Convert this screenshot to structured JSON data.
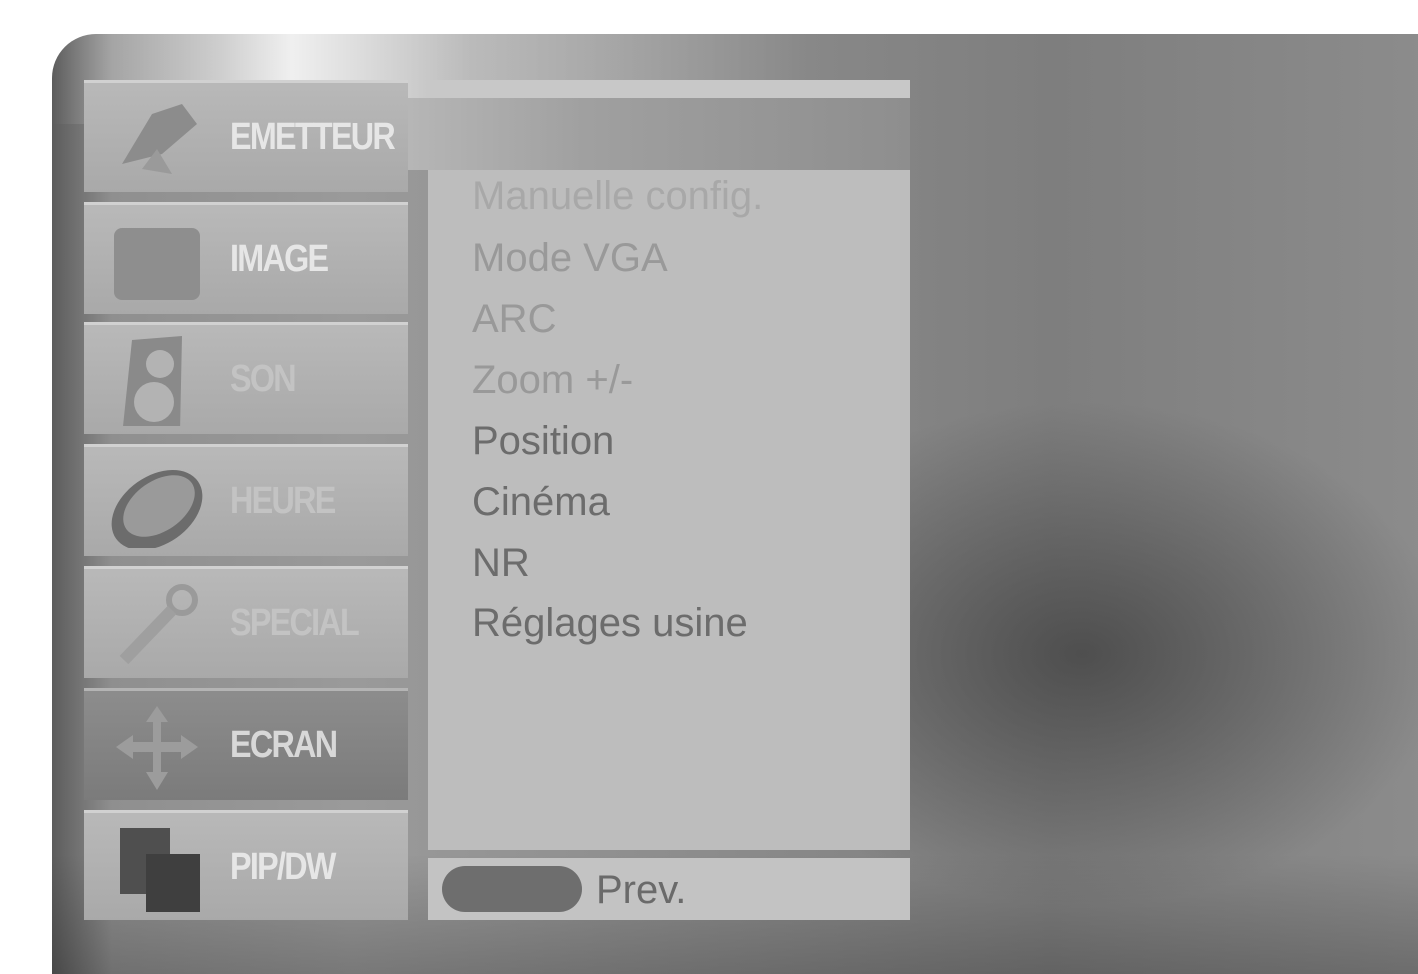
{
  "menu": {
    "items": [
      {
        "label": "EMETTEUR",
        "icon": "satellite-dish-icon"
      },
      {
        "label": "IMAGE",
        "icon": "picture-icon"
      },
      {
        "label": "SON",
        "icon": "speaker-icon"
      },
      {
        "label": "HEURE",
        "icon": "clock-icon"
      },
      {
        "label": "SPECIAL",
        "icon": "magnifier-icon"
      },
      {
        "label": "ECRAN",
        "icon": "four-arrows-icon"
      },
      {
        "label": "PIP/DW",
        "icon": "pip-screens-icon"
      }
    ],
    "active_index": 5
  },
  "submenu": {
    "items": [
      "Manuelle config.",
      "Mode VGA",
      "ARC",
      "Zoom +/-",
      "Position",
      "Cinéma",
      "NR",
      "Réglages usine"
    ]
  },
  "footer": {
    "prev_label": "Prev.",
    "button_icon": "menu-button-pill-icon"
  }
}
